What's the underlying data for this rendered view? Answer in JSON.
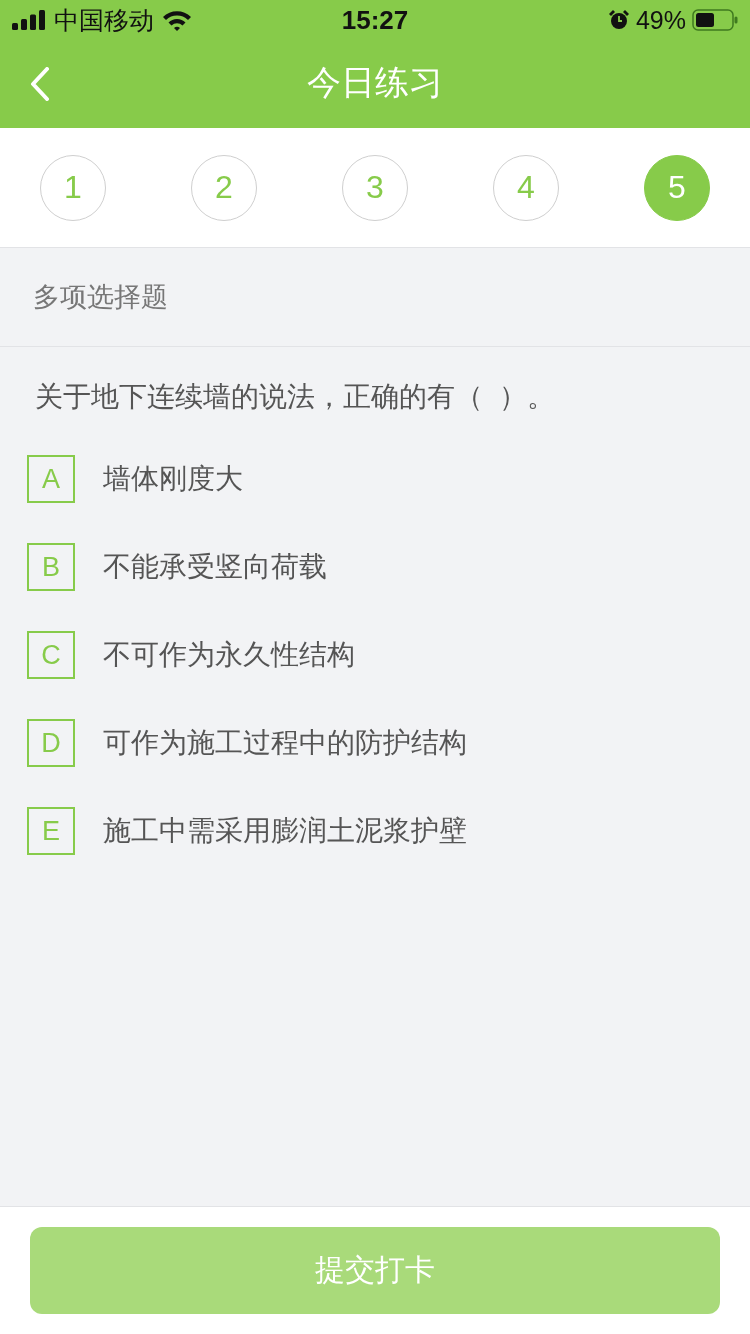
{
  "status_bar": {
    "carrier": "中国移动",
    "time": "15:27",
    "battery": "49%"
  },
  "nav_bar": {
    "title": "今日练习"
  },
  "question_nav": [
    {
      "label": "1",
      "selected": false
    },
    {
      "label": "2",
      "selected": false
    },
    {
      "label": "3",
      "selected": false
    },
    {
      "label": "4",
      "selected": false
    },
    {
      "label": "5",
      "selected": true
    }
  ],
  "section": {
    "title": "多项选择题"
  },
  "question": {
    "text": "关于地下连续墙的说法，正确的有（  ）。",
    "options": [
      {
        "letter": "A",
        "text": "墙体刚度大",
        "selected": false
      },
      {
        "letter": "B",
        "text": "不能承受竖向荷载",
        "selected": false
      },
      {
        "letter": "C",
        "text": "不可作为永久性结构",
        "selected": false
      },
      {
        "letter": "D",
        "text": "可作为施工过程中的防护结构",
        "selected": false
      },
      {
        "letter": "E",
        "text": "施工中需采用膨润土泥浆护壁",
        "selected": false
      }
    ]
  },
  "submit": {
    "label": "提交打卡",
    "disabled": true
  }
}
